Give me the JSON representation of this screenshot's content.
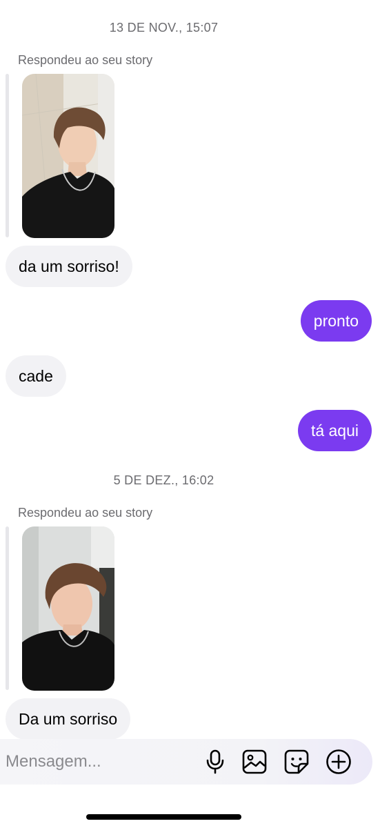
{
  "conversation": {
    "timestamps": [
      "13 DE NOV., 15:07",
      "5 DE DEZ., 16:02"
    ],
    "story_reply_label": "Respondeu ao seu story",
    "messages": [
      {
        "direction": "incoming",
        "text": "da um sorriso!"
      },
      {
        "direction": "outgoing",
        "text": "pronto"
      },
      {
        "direction": "incoming",
        "text": "cade"
      },
      {
        "direction": "outgoing",
        "text": "tá aqui"
      },
      {
        "direction": "incoming",
        "text": "Da um sorriso"
      }
    ]
  },
  "composer": {
    "placeholder": "Mensagem...",
    "icons": [
      "microphone-icon",
      "image-icon",
      "sticker-icon",
      "plus-icon"
    ]
  },
  "colors": {
    "outgoing_bubble": "#7b3bf0",
    "incoming_bubble": "#f2f2f5",
    "timestamp_text": "#6b6b6f"
  }
}
